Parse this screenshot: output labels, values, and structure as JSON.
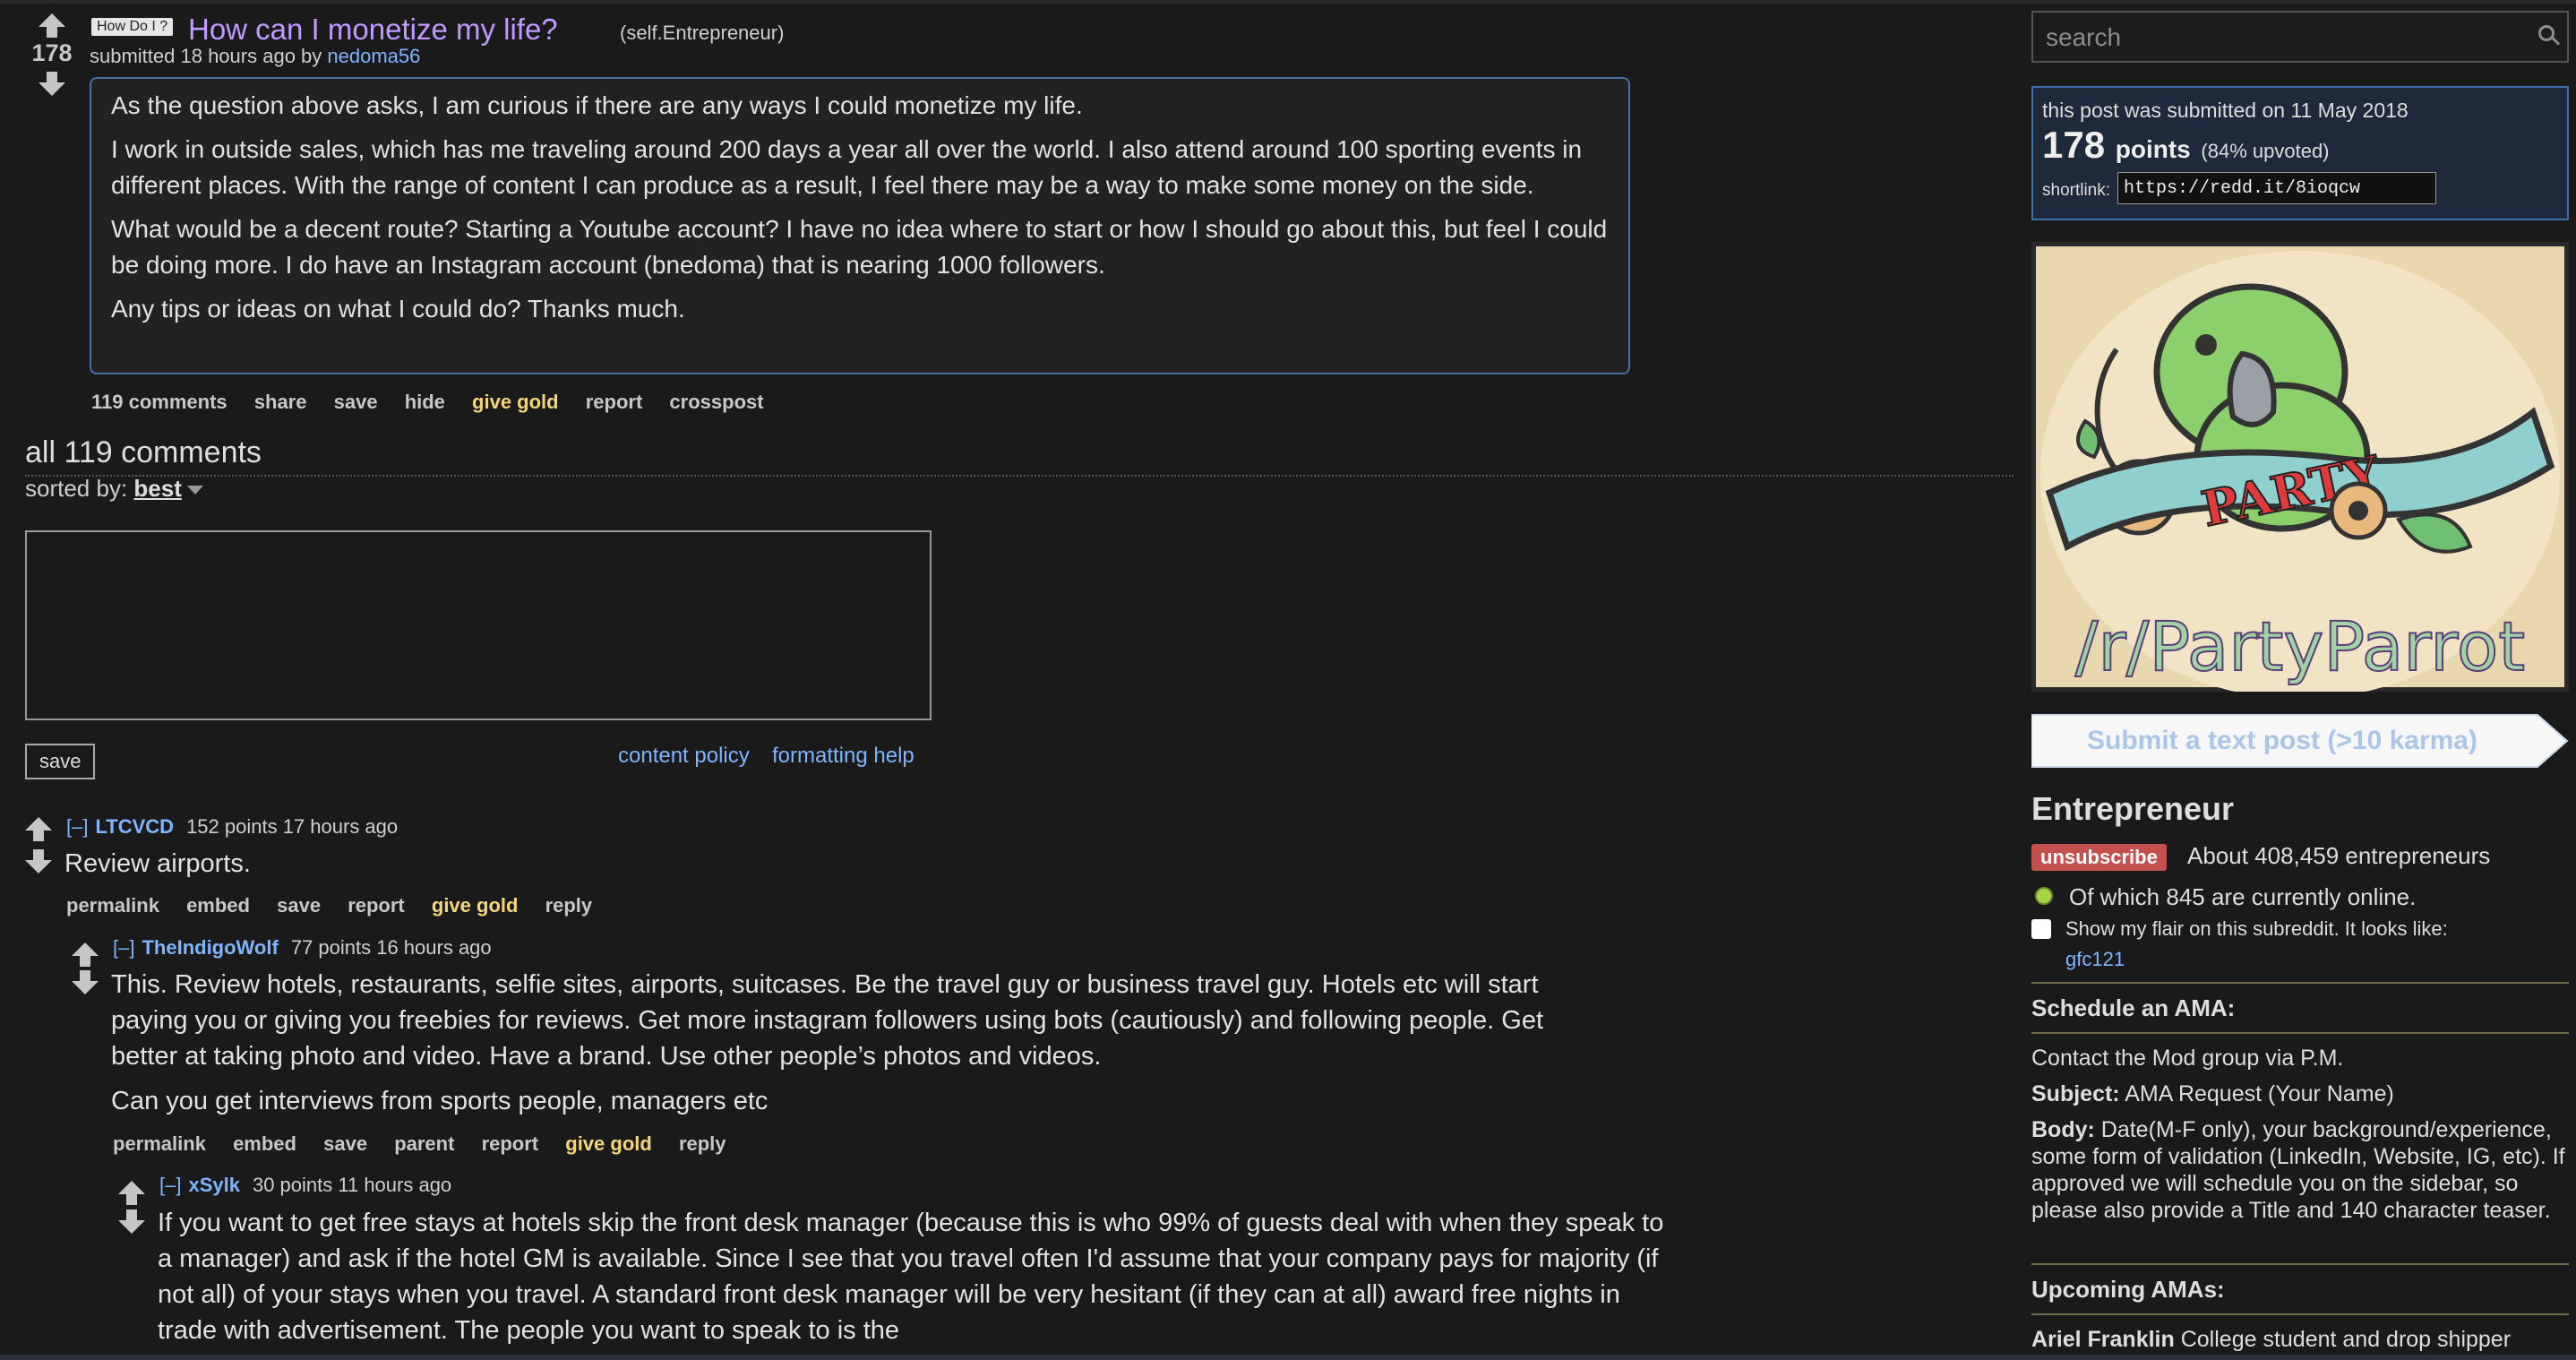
{
  "post": {
    "score": "178",
    "flair": "How Do I ?",
    "title": "How can I monetize my life?",
    "domain": "(self.Entrepreneur)",
    "submitted_prefix": "submitted 18 hours ago by",
    "author": "nedoma56",
    "paragraphs": [
      "As the question above asks, I am curious if there are any ways I could monetize my life.",
      "I work in outside sales, which has me traveling around 200 days a year all over the world. I also attend around 100 sporting events in different places. With the range of content I can produce as a result, I feel there may be a way to make some money on the side.",
      "What would be a decent route? Starting a Youtube account? I have no idea where to start or how I should go about this, but feel I could be doing more. I do have an Instagram account (bnedoma) that is nearing 1000 followers.",
      "Any tips or ideas on what I could do? Thanks much."
    ],
    "buttons": {
      "comments": "119 comments",
      "share": "share",
      "save": "save",
      "hide": "hide",
      "give_gold": "give gold",
      "report": "report",
      "crosspost": "crosspost"
    }
  },
  "comments_area": {
    "title": "all 119 comments",
    "sorted_by_label": "sorted by:",
    "sorted_by_value": "best",
    "save_label": "save",
    "content_policy": "content policy",
    "formatting_help": "formatting help"
  },
  "comments": [
    {
      "toggle": "[–]",
      "author": "LTCVCD",
      "meta": "152 points 17 hours ago",
      "paragraphs": [
        "Review airports."
      ],
      "buttons": [
        "permalink",
        "embed",
        "save",
        "report",
        "give gold",
        "reply"
      ]
    },
    {
      "toggle": "[–]",
      "author": "TheIndigoWolf",
      "meta": "77 points 16 hours ago",
      "paragraphs": [
        "This. Review hotels, restaurants, selfie sites, airports, suitcases. Be the travel guy or business travel guy. Hotels etc will start paying you or giving you freebies for reviews. Get more instagram followers using bots (cautiously) and following people. Get better at taking photo and video. Have a brand. Use other people’s photos and videos.",
        "Can you get interviews from sports people, managers etc"
      ],
      "buttons": [
        "permalink",
        "embed",
        "save",
        "parent",
        "report",
        "give gold",
        "reply"
      ]
    },
    {
      "toggle": "[–]",
      "author": "xSylk",
      "meta": "30 points 11 hours ago",
      "paragraphs": [
        "If you want to get free stays at hotels skip the front desk manager (because this is who 99% of guests deal with when they speak to a manager) and ask if the hotel GM is available. Since I see that you travel often I'd assume that your company pays for majority (if not all) of your stays when you travel. A standard front desk manager will be very hesitant (if they can at all) award free nights in trade with advertisement. The people you want to speak to is the"
      ]
    }
  ],
  "sidebar": {
    "search_placeholder": "search",
    "submitted_on": "this post was submitted on 11 May 2018",
    "points": "178",
    "points_word": "points",
    "upvoted": "(84% upvoted)",
    "shortlink_label": "shortlink:",
    "shortlink": "https://redd.it/8ioqcw",
    "banner_text": "/r/PartyParrot",
    "banner_ribbon": "PARTY",
    "submit_label": "Submit a text post (>10 karma)",
    "subreddit": "Entrepreneur",
    "unsubscribe": "unsubscribe",
    "subscribers": "About 408,459 entrepreneurs",
    "online": "Of which 845 are currently online.",
    "flair_text": "Show my flair on this subreddit. It looks like:",
    "flair_user": "gfc121",
    "ama_heading": "Schedule an AMA:",
    "ama_contact": "Contact the Mod group via P.M.",
    "subject_label": "Subject:",
    "subject_value": "AMA Request (Your Name)",
    "body_label": "Body:",
    "body_value": "Date(M-F only), your background/experience, some form of validation (LinkedIn, Website, IG, etc). If approved we will schedule you on the sidebar, so please also provide a Title and 140 character teaser.",
    "upcoming_heading": "Upcoming AMAs:",
    "upcoming_name": "Ariel Franklin",
    "upcoming_desc": "College student and drop shipper"
  },
  "colors": {
    "background": "#1a1a1b",
    "title": "#c09aff",
    "link": "#7fb5ff",
    "gold": "#f4d679",
    "unsubscribe": "#c4504e"
  }
}
